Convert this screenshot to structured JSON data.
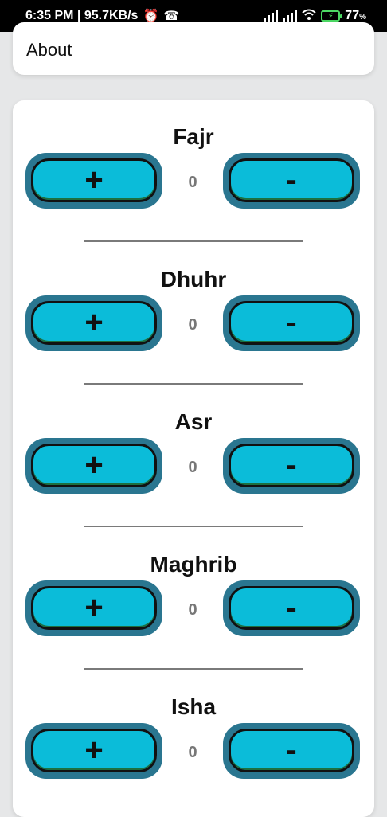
{
  "status_bar": {
    "time_speed": "6:35 PM | 95.7KB/s",
    "alarm_icon": "alarm-icon",
    "call_icon": "missed-call-icon",
    "wifi_icon": "wifi-icon",
    "battery_percent": "77",
    "battery_unit": "%"
  },
  "top_card": {
    "about_label": "About"
  },
  "prayers": [
    {
      "name": "Fajr",
      "plus_label": "+",
      "minus_label": "-",
      "count": "0"
    },
    {
      "name": "Dhuhr",
      "plus_label": "+",
      "minus_label": "-",
      "count": "0"
    },
    {
      "name": "Asr",
      "plus_label": "+",
      "minus_label": "-",
      "count": "0"
    },
    {
      "name": "Maghrib",
      "plus_label": "+",
      "minus_label": "-",
      "count": "0"
    },
    {
      "name": "Isha",
      "plus_label": "+",
      "minus_label": "-",
      "count": "0"
    }
  ],
  "colors": {
    "button_outer": "#2a7690",
    "button_inner": "#0bbcd9",
    "count_text": "#777777"
  }
}
